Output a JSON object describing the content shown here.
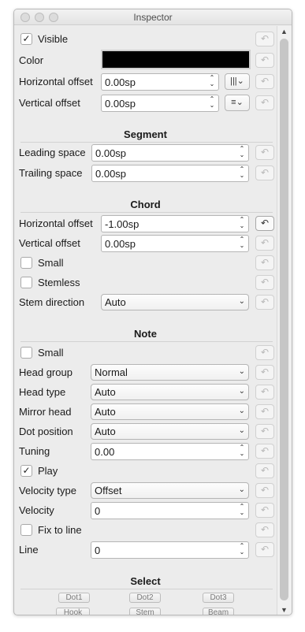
{
  "window": {
    "title": "Inspector"
  },
  "general": {
    "visible_label": "Visible",
    "visible_checked": true,
    "color_label": "Color",
    "color_value": "#000000",
    "h_offset_label": "Horizontal offset",
    "h_offset_value": "0.00sp",
    "v_offset_label": "Vertical offset",
    "v_offset_value": "0.00sp"
  },
  "segment": {
    "title": "Segment",
    "leading_label": "Leading space",
    "leading_value": "0.00sp",
    "trailing_label": "Trailing space",
    "trailing_value": "0.00sp"
  },
  "chord": {
    "title": "Chord",
    "h_offset_label": "Horizontal offset",
    "h_offset_value": "-1.00sp",
    "v_offset_label": "Vertical offset",
    "v_offset_value": "0.00sp",
    "small_label": "Small",
    "stemless_label": "Stemless",
    "stem_dir_label": "Stem direction",
    "stem_dir_value": "Auto"
  },
  "note": {
    "title": "Note",
    "small_label": "Small",
    "head_group_label": "Head group",
    "head_group_value": "Normal",
    "head_type_label": "Head type",
    "head_type_value": "Auto",
    "mirror_label": "Mirror head",
    "mirror_value": "Auto",
    "dot_pos_label": "Dot position",
    "dot_pos_value": "Auto",
    "tuning_label": "Tuning",
    "tuning_value": "0.00",
    "play_label": "Play",
    "play_checked": true,
    "velocity_type_label": "Velocity type",
    "velocity_type_value": "Offset",
    "velocity_label": "Velocity",
    "velocity_value": "0",
    "fix_label": "Fix to line",
    "line_label": "Line",
    "line_value": "0"
  },
  "select": {
    "title": "Select",
    "dot1": "Dot1",
    "dot2": "Dot2",
    "dot3": "Dot3",
    "hook": "Hook",
    "stem": "Stem",
    "beam": "Beam"
  },
  "icons": {
    "reset": "reset-arrow-icon",
    "spinner": "spinner-arrows-icon",
    "dropdown": "chevron-down-icon"
  }
}
